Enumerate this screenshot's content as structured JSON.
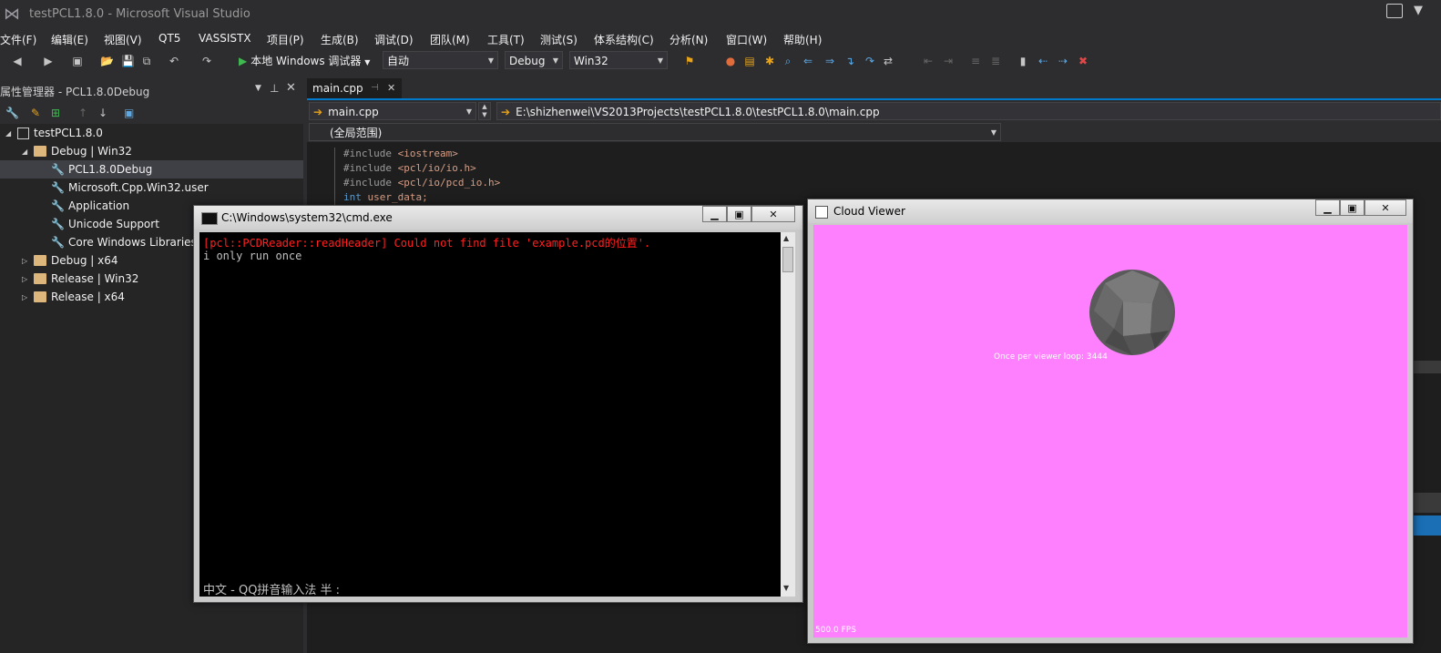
{
  "window": {
    "title": "testPCL1.8.0 - Microsoft Visual Studio"
  },
  "menu": [
    "文件(F)",
    "编辑(E)",
    "视图(V)",
    "QT5",
    "VASSISTX",
    "项目(P)",
    "生成(B)",
    "调试(D)",
    "团队(M)",
    "工具(T)",
    "测试(S)",
    "体系结构(C)",
    "分析(N)",
    "窗口(W)",
    "帮助(H)"
  ],
  "toolbar": {
    "run_label": "本地 Windows 调试器",
    "solution_config": "自动",
    "build_config": "Debug",
    "platform": "Win32"
  },
  "property_manager": {
    "title": "属性管理器 - PCL1.8.0Debug",
    "tree": [
      {
        "label": "testPCL1.8.0"
      },
      {
        "label": "Debug | Win32"
      },
      {
        "label": "PCL1.8.0Debug"
      },
      {
        "label": "Microsoft.Cpp.Win32.user"
      },
      {
        "label": "Application"
      },
      {
        "label": "Unicode Support"
      },
      {
        "label": "Core Windows Libraries"
      },
      {
        "label": "Debug | x64"
      },
      {
        "label": "Release | Win32"
      },
      {
        "label": "Release | x64"
      }
    ]
  },
  "editor": {
    "tab_label": "main.cpp",
    "nav_file": "main.cpp",
    "nav_path": "E:\\shizhenwei\\VS2013Projects\\testPCL1.8.0\\testPCL1.8.0\\main.cpp",
    "scope": "(全局范围)",
    "code": [
      {
        "pre": "#include ",
        "arg": "<iostream>"
      },
      {
        "pre": "#include ",
        "arg": "<pcl/io/io.h>"
      },
      {
        "pre": "#include ",
        "arg": "<pcl/io/pcd_io.h>"
      },
      {
        "kw": "int ",
        "arg": "user_data;"
      }
    ]
  },
  "cmd": {
    "title": "C:\\Windows\\system32\\cmd.exe",
    "lines": [
      {
        "text": "[pcl::PCDReader::readHeader] Could not find file 'example.pcd的位置'.",
        "color": "#ff2020"
      },
      {
        "text": "i only run once",
        "color": "#c0c0c0"
      }
    ],
    "ime_status": "中文 - QQ拼音输入法 半 :"
  },
  "cloud_viewer": {
    "title": "Cloud Viewer",
    "loop_text": "Once per viewer loop: 3444",
    "fps_text": "500.0 FPS",
    "background": "#ff80ff"
  },
  "colors": {
    "accent": "#007acc",
    "cmd_error": "#ff2020"
  }
}
